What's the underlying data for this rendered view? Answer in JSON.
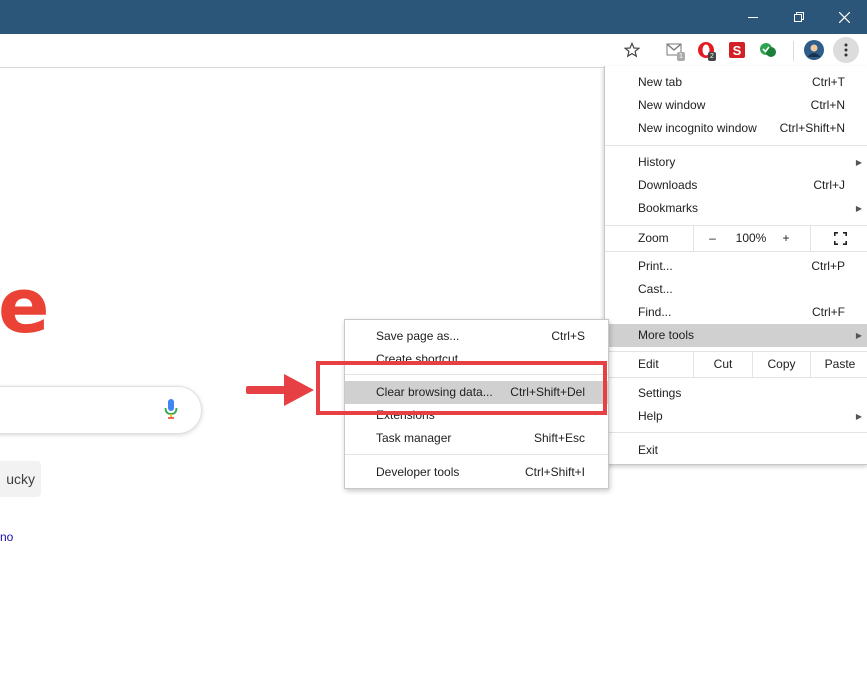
{
  "window": {
    "controls": [
      "minimize-icon",
      "restore-icon",
      "close-icon"
    ]
  },
  "toolbar": {
    "extensions": [
      {
        "icon": "gmail-checker-icon",
        "badge": "1"
      },
      {
        "icon": "opera-adblock-icon",
        "badge": "2"
      },
      {
        "icon": "s-extension-icon",
        "badge": ""
      },
      {
        "icon": "grammar-extension-icon",
        "badge": ""
      }
    ]
  },
  "page": {
    "logo_fragment": "e",
    "lucky_fragment": "ucky",
    "link_fragment": "no"
  },
  "menu": {
    "new_tab": {
      "label": "New tab",
      "shortcut": "Ctrl+T"
    },
    "new_window": {
      "label": "New window",
      "shortcut": "Ctrl+N"
    },
    "new_incognito": {
      "label": "New incognito window",
      "shortcut": "Ctrl+Shift+N"
    },
    "history": {
      "label": "History"
    },
    "downloads": {
      "label": "Downloads",
      "shortcut": "Ctrl+J"
    },
    "bookmarks": {
      "label": "Bookmarks"
    },
    "zoom": {
      "label": "Zoom",
      "minus": "–",
      "value": "100%",
      "plus": "+"
    },
    "print": {
      "label": "Print...",
      "shortcut": "Ctrl+P"
    },
    "cast": {
      "label": "Cast..."
    },
    "find": {
      "label": "Find...",
      "shortcut": "Ctrl+F"
    },
    "more_tools": {
      "label": "More tools"
    },
    "edit": {
      "label": "Edit",
      "cut": "Cut",
      "copy": "Copy",
      "paste": "Paste"
    },
    "settings": {
      "label": "Settings"
    },
    "help": {
      "label": "Help"
    },
    "exit": {
      "label": "Exit"
    }
  },
  "submenu": {
    "save_page": {
      "label": "Save page as...",
      "shortcut": "Ctrl+S"
    },
    "create_shortcut": {
      "label": "Create shortcut"
    },
    "clear_browsing": {
      "label": "Clear browsing data...",
      "shortcut": "Ctrl+Shift+Del"
    },
    "extensions": {
      "label": "Extensions"
    },
    "task_manager": {
      "label": "Task manager",
      "shortcut": "Shift+Esc"
    },
    "developer_tools": {
      "label": "Developer tools",
      "shortcut": "Ctrl+Shift+I"
    }
  },
  "colors": {
    "titlebar": "#2b5579",
    "highlight": "#d0d0d0",
    "annotation": "#e64044",
    "logo": "#ea4335"
  }
}
